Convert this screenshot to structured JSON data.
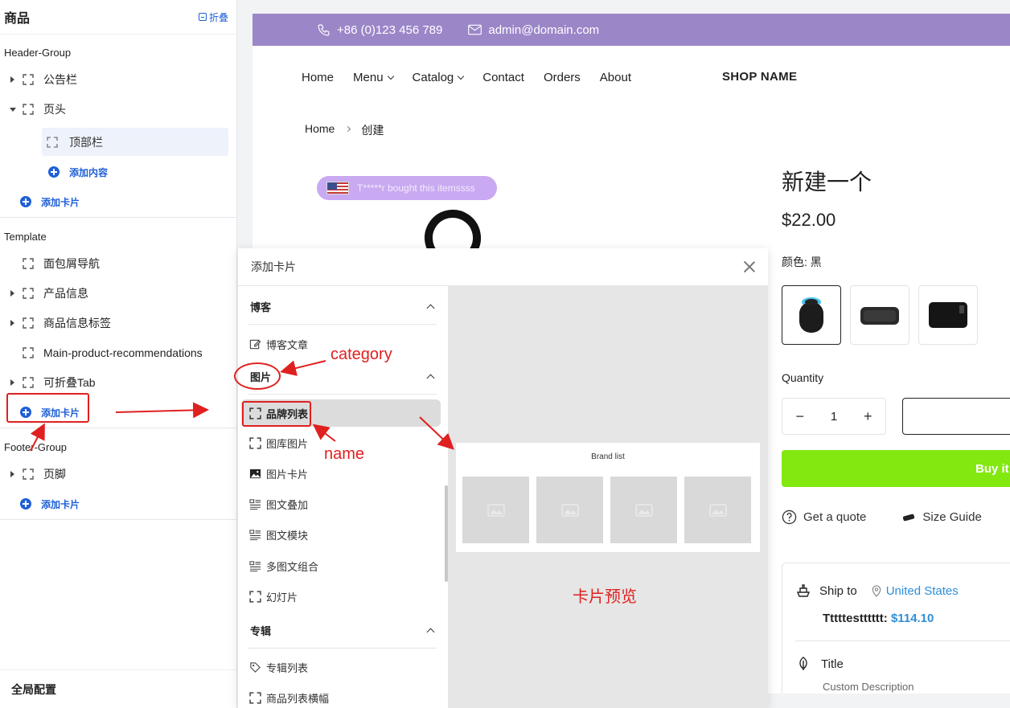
{
  "sidebar": {
    "title": "商品",
    "collapse_label": "折叠",
    "groups": {
      "header": "Header-Group",
      "template": "Template",
      "footer": "Footer-Group"
    },
    "header_items": {
      "announcement": "公告栏",
      "header": "页头",
      "topbar": "顶部栏",
      "add_content": "添加内容",
      "add_card": "添加卡片"
    },
    "template_items": {
      "breadcrumb": "面包屑导航",
      "product_info": "产品信息",
      "product_tags": "商品信息标签",
      "recommendations": "Main-product-recommendations",
      "collapsible_tab": "可折叠Tab",
      "add_card": "添加卡片"
    },
    "footer_items": {
      "footer": "页脚",
      "add_card": "添加卡片"
    },
    "global_config": "全局配置"
  },
  "shop": {
    "phone": "+86 (0)123 456 789",
    "email": "admin@domain.com",
    "nav": [
      "Home",
      "Menu",
      "Catalog",
      "Contact",
      "Orders",
      "About"
    ],
    "shop_name": "SHOP NAME",
    "breadcrumb": [
      "Home",
      "创建"
    ],
    "toast": "T*****r bought this itemssss",
    "product_title": "新建一个",
    "price": "$22.00",
    "color_label": "颜色: 黑",
    "quantity_label": "Quantity",
    "quantity": "1",
    "buy_label": "Buy it n",
    "quote_label": "Get a quote",
    "size_guide_label": "Size Guide",
    "ship_to_label": "Ship to",
    "ship_country": "United States",
    "ship_total_label": "Tttttestttttt:",
    "ship_total_amount": "$114.10",
    "info_title": "Title",
    "info_desc": "Custom Description",
    "colors": {
      "topbar": "#9b86c8",
      "buy": "#82e810",
      "link": "#2f8ed8"
    }
  },
  "modal": {
    "title": "添加卡片",
    "categories": [
      {
        "name": "博客",
        "items": [
          "博客文章"
        ]
      },
      {
        "name": "图片",
        "items": [
          "品牌列表",
          "图库图片",
          "图片卡片",
          "图文叠加",
          "图文模块",
          "多图文组合",
          "幻灯片"
        ]
      },
      {
        "name": "专辑",
        "items": [
          "专辑列表",
          "商品列表横幅"
        ]
      }
    ],
    "preview_title": "Brand list"
  },
  "annotations": {
    "category": "category",
    "name": "name",
    "preview": "卡片预览",
    "color": "#e02020"
  }
}
